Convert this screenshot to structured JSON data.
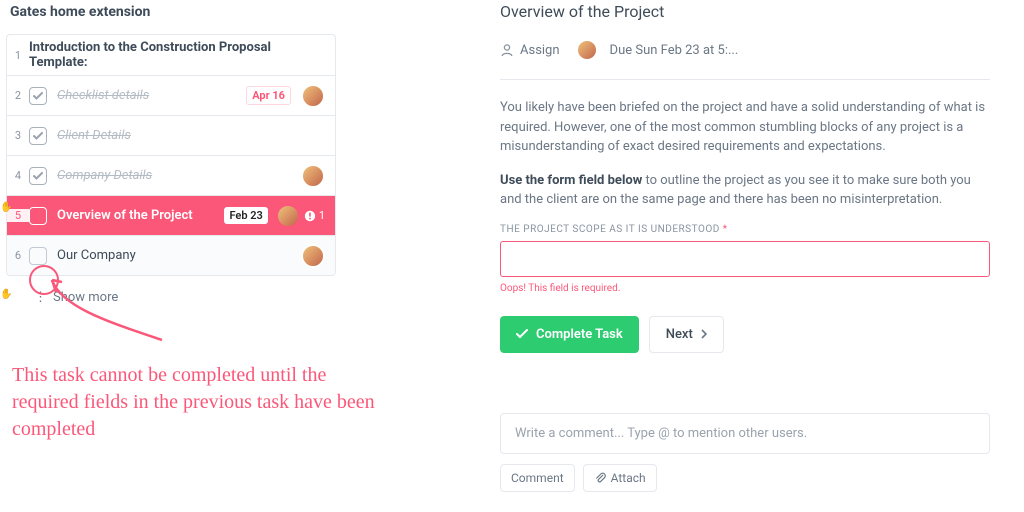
{
  "colors": {
    "accent": "#fb5779",
    "success": "#2ecc71"
  },
  "left": {
    "title": "Gates home extension",
    "rows": [
      {
        "num": "1",
        "label": "Introduction to the Construction Proposal Template:",
        "kind": "header"
      },
      {
        "num": "2",
        "label": "Checklist details",
        "kind": "done",
        "date": "Apr 16",
        "avatar": true
      },
      {
        "num": "3",
        "label": "Client Details",
        "kind": "done"
      },
      {
        "num": "4",
        "label": "Company Details",
        "kind": "done",
        "avatar": true
      },
      {
        "num": "5",
        "label": "Overview of the Project",
        "kind": "active",
        "date": "Feb 23",
        "avatar": true,
        "warn_count": "1"
      },
      {
        "num": "6",
        "label": "Our Company",
        "kind": "open",
        "avatar": true
      }
    ],
    "show_more": "Show more"
  },
  "annotation": "This task cannot be completed until the required fields in the previous task have been completed",
  "right": {
    "title": "Overview of the Project",
    "assign_label": "Assign",
    "due_text": "Due Sun Feb 23 at 5:...",
    "p1": "You likely have been briefed on the project and have a solid understanding of what is required. However, one of the most common stumbling blocks of any project is a misunderstanding of exact desired requirements and expectations.",
    "p2_bold": "Use the form field below",
    "p2_rest": " to outline the project as you see it to make sure both you and the client are on the same page and there has been no misinterpretation.",
    "field_label": "THE PROJECT SCOPE AS IT IS UNDERSTOOD",
    "field_error": "Oops! This field is required.",
    "complete_btn": "Complete Task",
    "next_btn": "Next",
    "comment_placeholder": "Write a comment... Type @ to mention other users.",
    "comment_btn": "Comment",
    "attach_btn": "Attach"
  }
}
